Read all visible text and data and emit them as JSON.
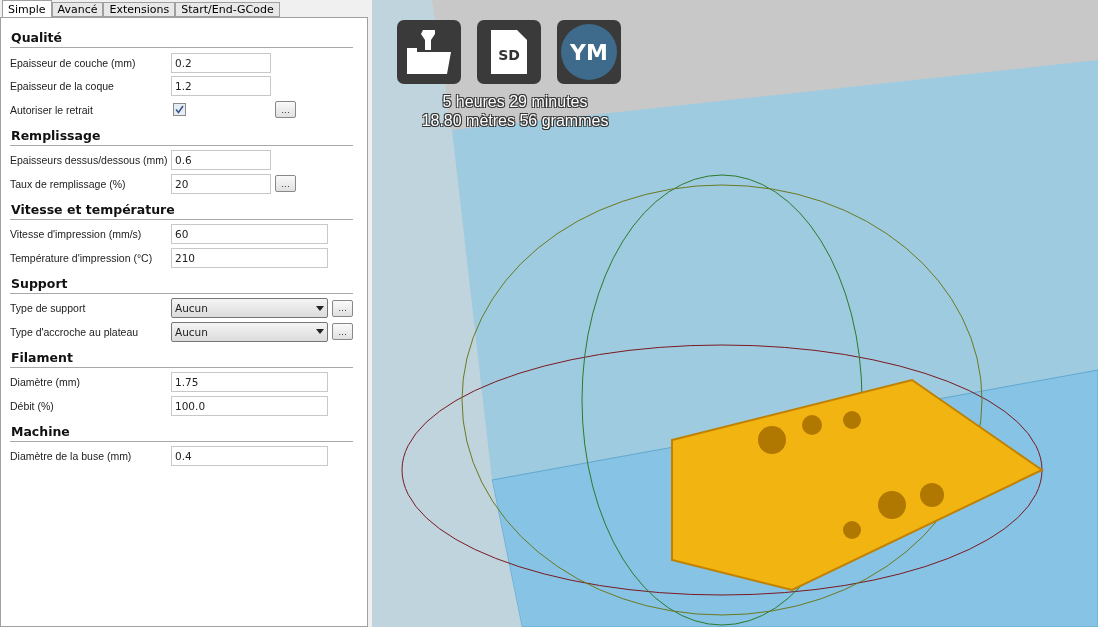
{
  "tabs": [
    {
      "label": "Simple",
      "selected": true
    },
    {
      "label": "Avancé",
      "selected": false
    },
    {
      "label": "Extensions",
      "selected": false
    },
    {
      "label": "Start/End-GCode",
      "selected": false
    }
  ],
  "sections": [
    {
      "title": "Qualité",
      "rows": [
        {
          "kind": "text",
          "label": "Epaisseur de couche (mm)",
          "value": "0.2"
        },
        {
          "kind": "text",
          "label": "Epaisseur de la coque",
          "value": "1.2"
        },
        {
          "kind": "checkbox",
          "label": "Autoriser le retrait",
          "checked": true,
          "options": "..."
        }
      ]
    },
    {
      "title": "Remplissage",
      "rows": [
        {
          "kind": "text",
          "label": "Epaisseurs dessus/dessous (mm)",
          "value": "0.6"
        },
        {
          "kind": "text",
          "label": "Taux de remplissage (%)",
          "value": "20",
          "options": "..."
        }
      ]
    },
    {
      "title": "Vitesse et température",
      "rows": [
        {
          "kind": "text",
          "label": "Vitesse d'impression (mm/s)",
          "value": "60"
        },
        {
          "kind": "text",
          "label": "Température d'impression (°C)",
          "value": "210"
        }
      ]
    },
    {
      "title": "Support",
      "rows": [
        {
          "kind": "select",
          "label": "Type de support",
          "value": "Aucun",
          "options": "..."
        },
        {
          "kind": "select",
          "label": "Type d'accroche au plateau",
          "value": "Aucun",
          "options": "..."
        }
      ]
    },
    {
      "title": "Filament",
      "rows": [
        {
          "kind": "text",
          "label": "Diamètre (mm)",
          "value": "1.75"
        },
        {
          "kind": "text",
          "label": "Débit (%)",
          "value": "100.0"
        }
      ]
    },
    {
      "title": "Machine",
      "rows": [
        {
          "kind": "text",
          "label": "Diamètre de la buse (mm)",
          "value": "0.4"
        }
      ]
    }
  ],
  "viewport": {
    "badge": "YM",
    "sd_label": "SD",
    "print_time": "5 heures 29 minutes",
    "print_material": "18.80 mètres 56 grammes"
  }
}
